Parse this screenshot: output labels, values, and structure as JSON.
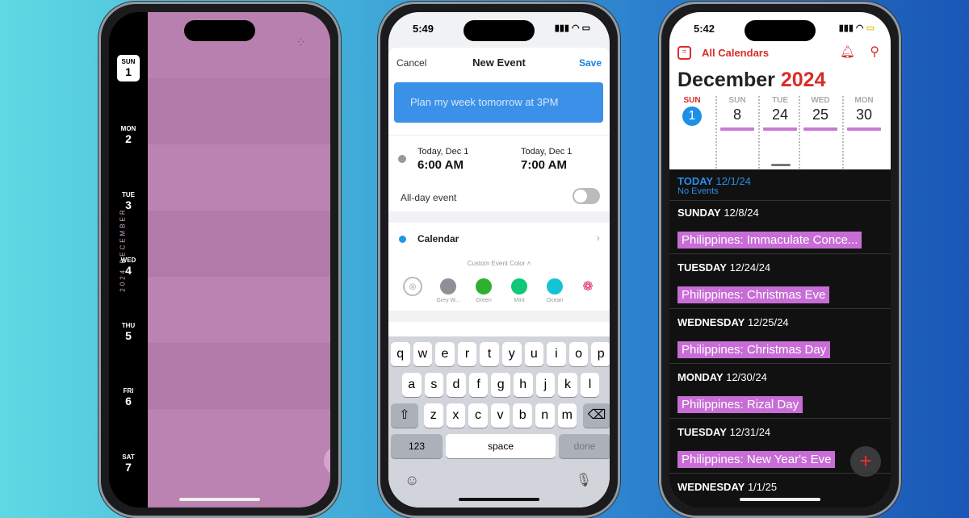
{
  "left_phone": {
    "month_label": "2024 DECEMBER",
    "days": [
      {
        "dow": "SUN",
        "date": "1",
        "selected": true
      },
      {
        "dow": "MON",
        "date": "2"
      },
      {
        "dow": "TUE",
        "date": "3"
      },
      {
        "dow": "WED",
        "date": "4"
      },
      {
        "dow": "THU",
        "date": "5"
      },
      {
        "dow": "FRI",
        "date": "6"
      },
      {
        "dow": "SAT",
        "date": "7"
      }
    ],
    "add_label": "+",
    "color": "#b77fad"
  },
  "middle_phone": {
    "time": "5:49",
    "cancel": "Cancel",
    "title": "New Event",
    "save": "Save",
    "input_placeholder": "Plan my week tomorrow at 3PM",
    "start": {
      "day": "Today, Dec 1",
      "time": "6:00 AM"
    },
    "end": {
      "day": "Today, Dec 1",
      "time": "7:00 AM"
    },
    "all_day_label": "All-day event",
    "all_day_on": false,
    "calendar_label": "Calendar",
    "custom_color_label": "Custom Event Color",
    "colors": [
      {
        "name": "Grey W...",
        "hex": "#8e9097"
      },
      {
        "name": "Green",
        "hex": "#2fb02f"
      },
      {
        "name": "Mint",
        "hex": "#10c77a"
      },
      {
        "name": "Ocean",
        "hex": "#12c4d6"
      }
    ],
    "keyboard": {
      "row1": [
        "q",
        "w",
        "e",
        "r",
        "t",
        "y",
        "u",
        "i",
        "o",
        "p"
      ],
      "row2": [
        "a",
        "s",
        "d",
        "f",
        "g",
        "h",
        "j",
        "k",
        "l"
      ],
      "row3": [
        "z",
        "x",
        "c",
        "v",
        "b",
        "n",
        "m"
      ],
      "numbers": "123",
      "space": "space",
      "done": "done"
    }
  },
  "right_phone": {
    "time": "5:42",
    "all_calendars": "All Calendars",
    "month": "December",
    "year": "2024",
    "strip": [
      {
        "dow": "SUN",
        "date": "1",
        "today": true
      },
      {
        "dow": "SUN",
        "date": "8"
      },
      {
        "dow": "TUE",
        "date": "24"
      },
      {
        "dow": "WED",
        "date": "25"
      },
      {
        "dow": "MON",
        "date": "30"
      }
    ],
    "today": {
      "label": "TODAY",
      "date": "12/1/24",
      "note": "No Events"
    },
    "events": [
      {
        "day": "SUNDAY",
        "date": "12/8/24",
        "title": "Philippines: Immaculate Conce..."
      },
      {
        "day": "TUESDAY",
        "date": "12/24/24",
        "title": "Philippines: Christmas Eve"
      },
      {
        "day": "WEDNESDAY",
        "date": "12/25/24",
        "title": "Philippines: Christmas Day"
      },
      {
        "day": "MONDAY",
        "date": "12/30/24",
        "title": "Philippines: Rizal Day"
      },
      {
        "day": "TUESDAY",
        "date": "12/31/24",
        "title": "Philippines: New Year's Eve"
      },
      {
        "day": "WEDNESDAY",
        "date": "1/1/25"
      }
    ],
    "add_label": "+",
    "accent": "#d92b2b",
    "event_color": "#c86dd6"
  }
}
